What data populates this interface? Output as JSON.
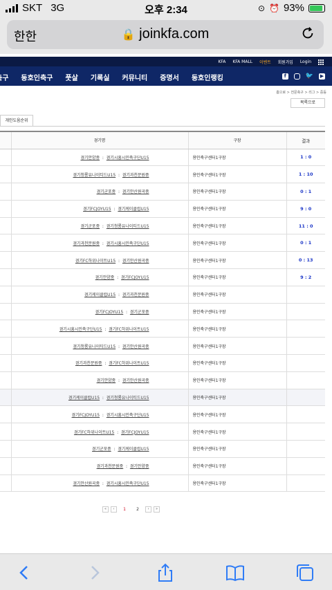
{
  "status": {
    "carrier": "SKT",
    "network": "3G",
    "time": "오후 2:34",
    "battery": "93%"
  },
  "urlbar": {
    "aa": "한한",
    "url": "joinkfa.com"
  },
  "topbar": {
    "links": [
      "KFA",
      "KFA MALL",
      "이벤트",
      "회원가입",
      "Login"
    ]
  },
  "nav": {
    "items": [
      "축구",
      "동호인축구",
      "풋살",
      "기록실",
      "커뮤니티",
      "증명서",
      "동호인랭킹"
    ]
  },
  "breadcrumb": "홈으로 > 전문축구 > 리그 > 중등",
  "list_button": "목록으로",
  "tab_label": "개인도움순위",
  "table": {
    "headers": [
      "경기명",
      "구장",
      "결과"
    ],
    "rows": [
      {
        "home": "경기안양중",
        "away": "경기시흥시민축구단U15",
        "venue": "용인축구센터1구장",
        "result": "1 : 0"
      },
      {
        "home": "경기청룡유나이티드U15",
        "away": "경기과천문원중",
        "venue": "용인축구센터1구장",
        "result": "1 : 10"
      },
      {
        "home": "경기군포중",
        "away": "경기안산원곡중",
        "venue": "용인축구센터1구장",
        "result": "0 : 1"
      },
      {
        "home": "경기FCJOYU15",
        "away": "경기케이클럽U15",
        "venue": "용인축구센터1구장",
        "result": "9 : 0"
      },
      {
        "home": "경기군포중",
        "away": "경기청룡유나이티드U15",
        "venue": "용인축구센터1구장",
        "result": "11 : 0"
      },
      {
        "home": "경기과천문원중",
        "away": "경기시흥시민축구단U15",
        "venue": "용인축구센터1구장",
        "result": "0 : 1"
      },
      {
        "home": "경기FC하위나이트U15",
        "away": "경기안산원곡중",
        "venue": "용인축구센터1구장",
        "result": "0 : 13"
      },
      {
        "home": "경기안양중",
        "away": "경기FCJOYU15",
        "venue": "용인축구센터1구장",
        "result": "9 : 2"
      },
      {
        "home": "경기케이클럽U15",
        "away": "경기과천문원중",
        "venue": "용인축구센터1구장",
        "result": ""
      },
      {
        "home": "경기FCJOYU15",
        "away": "경기군포중",
        "venue": "용인축구센터1구장",
        "result": ""
      },
      {
        "home": "경기시흥시민축구단U15",
        "away": "경기FC하위나이트U15",
        "venue": "용인축구센터1구장",
        "result": ""
      },
      {
        "home": "경기청룡유나이티드U15",
        "away": "경기안산원곡중",
        "venue": "용인축구센터1구장",
        "result": ""
      },
      {
        "home": "경기과천문원중",
        "away": "경기FC하위나이트U15",
        "venue": "용인축구센터1구장",
        "result": ""
      },
      {
        "home": "경기안양중",
        "away": "경기안산원곡중",
        "venue": "용인축구센터1구장",
        "result": ""
      },
      {
        "home": "경기케이클럽U15",
        "away": "경기청룡유나이티드U15",
        "venue": "용인축구센터1구장",
        "result": ""
      },
      {
        "home": "경기FCJOYU15",
        "away": "경기시흥시민축구단U15",
        "venue": "용인축구센터1구장",
        "result": ""
      },
      {
        "home": "경기FC하위나이트U15",
        "away": "경기FCJOYU15",
        "venue": "용인축구센터1구장",
        "result": ""
      },
      {
        "home": "경기군포중",
        "away": "경기케이클럽U15",
        "venue": "용인축구센터1구장",
        "result": ""
      },
      {
        "home": "경기과천문원중",
        "away": "경기안양중",
        "venue": "용인축구센터1구장",
        "result": ""
      },
      {
        "home": "경기안산원곡중",
        "away": "경기시흥시민축구단U15",
        "venue": "용인축구센터1구장",
        "result": ""
      }
    ]
  },
  "pager": {
    "first": "«",
    "prev": "‹",
    "pages": [
      "1",
      "2"
    ],
    "next": "›",
    "last": "»"
  },
  "separator": ":",
  "icons": [
    "signal-icon",
    "alarm-icon",
    "lock-icon",
    "reload-icon",
    "grid-icon",
    "facebook-icon",
    "instagram-icon",
    "twitter-icon",
    "youtube-icon",
    "back-icon",
    "forward-icon",
    "share-icon",
    "bookmarks-icon",
    "tabs-icon"
  ]
}
